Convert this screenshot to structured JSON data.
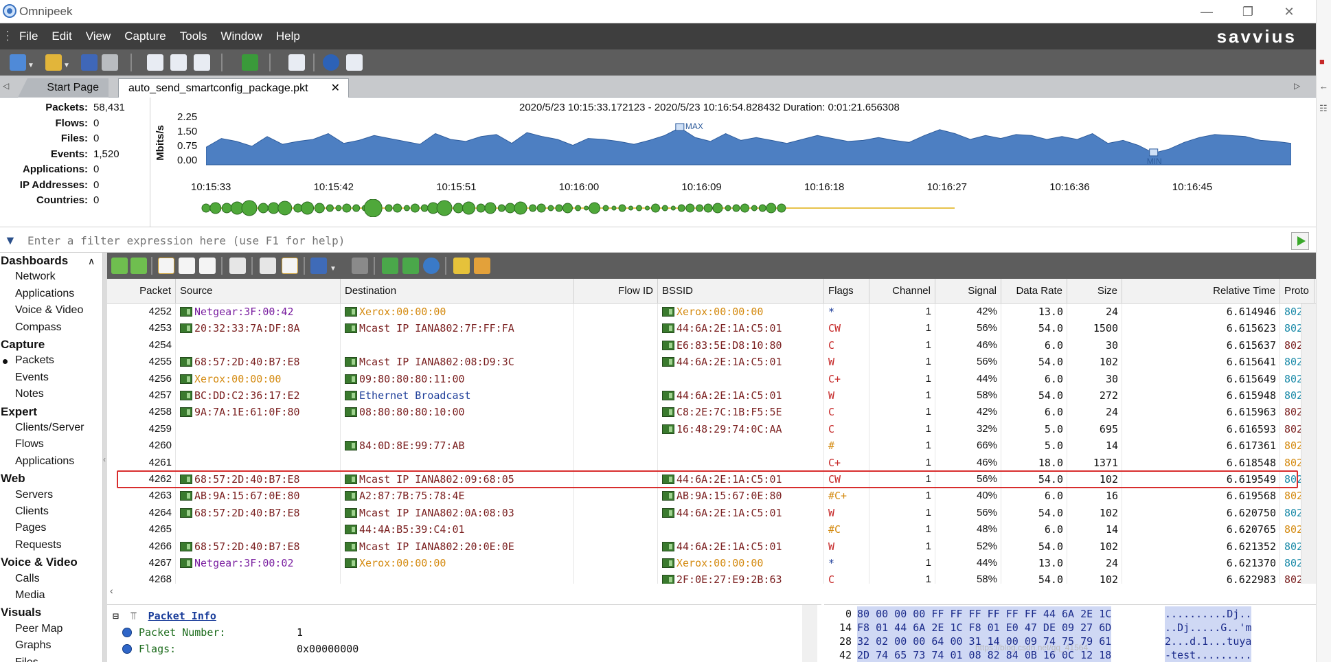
{
  "window": {
    "title": "Omnipeek",
    "minimize": "—",
    "maximize": "❐",
    "close": "✕"
  },
  "menu": [
    "File",
    "Edit",
    "View",
    "Capture",
    "Tools",
    "Window",
    "Help"
  ],
  "brand": "savvius",
  "tabs": {
    "start": "Start Page",
    "file": "auto_send_smartconfig_package.pkt",
    "close": "✕"
  },
  "summary": {
    "stats": [
      {
        "label": "Packets:",
        "value": "58,431"
      },
      {
        "label": "Flows:",
        "value": "0"
      },
      {
        "label": "Files:",
        "value": "0"
      },
      {
        "label": "Events:",
        "value": "1,520"
      },
      {
        "label": "Applications:",
        "value": "0"
      },
      {
        "label": "IP Addresses:",
        "value": "0"
      },
      {
        "label": "Countries:",
        "value": "0"
      }
    ],
    "range": "2020/5/23 10:15:33.172123 - 2020/5/23 10:16:54.828432  Duration: 0:01:21.656308",
    "y_title": "Mbits/s",
    "y_ticks": [
      "2.25",
      "1.50",
      "0.75",
      "0.00"
    ],
    "x_ticks": [
      "10:15:33",
      "10:15:42",
      "10:15:51",
      "10:16:00",
      "10:16:09",
      "10:16:18",
      "10:16:27",
      "10:16:36",
      "10:16:45"
    ],
    "max_label": "MAX",
    "min_label": "MIN"
  },
  "chart_data": {
    "type": "area",
    "title": "",
    "ylabel": "Mbits/s",
    "ylim": [
      0,
      2.25
    ],
    "x": [
      "10:15:33",
      "10:15:42",
      "10:15:51",
      "10:16:00",
      "10:16:09",
      "10:16:18",
      "10:16:27",
      "10:16:36",
      "10:16:45"
    ],
    "values": [
      0.9,
      1.35,
      1.2,
      0.95,
      1.45,
      1.05,
      1.2,
      1.3,
      1.6,
      1.1,
      1.25,
      1.5,
      1.35,
      1.2,
      1.05,
      1.6,
      1.3,
      1.2,
      1.45,
      1.55,
      1.1,
      1.65,
      1.45,
      1.3,
      1.0,
      1.35,
      1.3,
      1.2,
      1.05,
      1.25,
      1.5,
      1.9,
      1.4,
      1.2,
      1.6,
      1.25,
      1.4,
      1.25,
      1.1,
      1.3,
      1.5,
      1.35,
      1.2,
      1.25,
      1.4,
      1.25,
      1.15,
      1.5,
      1.8,
      1.6,
      1.3,
      1.5,
      1.35,
      1.55,
      1.5,
      1.3,
      1.45,
      1.3,
      1.6,
      1.1,
      1.25,
      1.0,
      0.6,
      0.8,
      1.15,
      1.4,
      1.55,
      1.5,
      1.45,
      1.25,
      1.2,
      1.1
    ]
  },
  "filter": {
    "placeholder": "Enter a filter expression here (use F1 for help)"
  },
  "nav": {
    "groups": [
      {
        "head": "Dashboards",
        "items": [
          "Network",
          "Applications",
          "Voice & Video",
          "Compass"
        ]
      },
      {
        "head": "Capture",
        "items": [
          "Packets",
          "Events",
          "Notes"
        ]
      },
      {
        "head": "Expert",
        "items": [
          "Clients/Server",
          "Flows",
          "Applications"
        ]
      },
      {
        "head": "Web",
        "items": [
          "Servers",
          "Clients",
          "Pages",
          "Requests"
        ]
      },
      {
        "head": "Voice & Video",
        "items": [
          "Calls",
          "Media"
        ]
      },
      {
        "head": "Visuals",
        "items": [
          "Peer Map",
          "Graphs",
          "Files"
        ]
      }
    ],
    "active": "Packets"
  },
  "columns": [
    "Packet",
    "Source",
    "Destination",
    "Flow ID",
    "BSSID",
    "Flags",
    "Channel",
    "Signal",
    "Data Rate",
    "Size",
    "Relative Time",
    "Proto"
  ],
  "colors": {
    "purple": "#7a1fa0",
    "orange": "#d48a10",
    "darkred": "#7a1f1f",
    "blue": "#1f3f9a",
    "red": "#c62828",
    "teal": "#1a8aa8"
  },
  "rows": [
    {
      "packet": "4252",
      "src": "Netgear:3F:00:42",
      "srcColor": "purple",
      "dst": "Xerox:00:00:00",
      "dstColor": "orange",
      "bssid": "Xerox:00:00:00",
      "bssidColor": "orange",
      "flags": "*",
      "channel": "1",
      "signal": "42%",
      "rate": "13.0",
      "size": "24",
      "time": "6.614946",
      "proto": "802",
      "protoColor": "teal"
    },
    {
      "packet": "4253",
      "src": "20:32:33:7A:DF:8A",
      "srcColor": "darkred",
      "dst": "Mcast IP IANA802:7F:FF:FA",
      "dstColor": "darkred",
      "bssid": "44:6A:2E:1A:C5:01",
      "bssidColor": "darkred",
      "flags": "CW",
      "channel": "1",
      "signal": "56%",
      "rate": "54.0",
      "size": "1500",
      "time": "6.615623",
      "proto": "802",
      "protoColor": "teal"
    },
    {
      "packet": "4254",
      "src": "",
      "srcColor": "darkred",
      "dst": "",
      "dstColor": "darkred",
      "bssid": "E6:83:5E:D8:10:80",
      "bssidColor": "darkred",
      "flags": "C",
      "channel": "1",
      "signal": "46%",
      "rate": "6.0",
      "size": "30",
      "time": "6.615637",
      "proto": "802",
      "protoColor": "darkred"
    },
    {
      "packet": "4255",
      "src": "68:57:2D:40:B7:E8",
      "srcColor": "darkred",
      "dst": "Mcast IP IANA802:08:D9:3C",
      "dstColor": "darkred",
      "bssid": "44:6A:2E:1A:C5:01",
      "bssidColor": "darkred",
      "flags": "W",
      "channel": "1",
      "signal": "56%",
      "rate": "54.0",
      "size": "102",
      "time": "6.615641",
      "proto": "802",
      "protoColor": "teal"
    },
    {
      "packet": "4256",
      "src": "Xerox:00:00:00",
      "srcColor": "orange",
      "dst": "09:80:80:80:11:00",
      "dstColor": "darkred",
      "bssid": "",
      "bssidColor": "darkred",
      "flags": "C+",
      "channel": "1",
      "signal": "44%",
      "rate": "6.0",
      "size": "30",
      "time": "6.615649",
      "proto": "802",
      "protoColor": "teal"
    },
    {
      "packet": "4257",
      "src": "BC:DD:C2:36:17:E2",
      "srcColor": "darkred",
      "dst": "Ethernet Broadcast",
      "dstColor": "blue",
      "bssid": "44:6A:2E:1A:C5:01",
      "bssidColor": "darkred",
      "flags": "W",
      "channel": "1",
      "signal": "58%",
      "rate": "54.0",
      "size": "272",
      "time": "6.615948",
      "proto": "802",
      "protoColor": "teal"
    },
    {
      "packet": "4258",
      "src": "9A:7A:1E:61:0F:80",
      "srcColor": "darkred",
      "dst": "08:80:80:80:10:00",
      "dstColor": "darkred",
      "bssid": "C8:2E:7C:1B:F5:5E",
      "bssidColor": "darkred",
      "flags": "C",
      "channel": "1",
      "signal": "42%",
      "rate": "6.0",
      "size": "24",
      "time": "6.615963",
      "proto": "802",
      "protoColor": "darkred"
    },
    {
      "packet": "4259",
      "src": "",
      "srcColor": "darkred",
      "dst": "",
      "dstColor": "darkred",
      "bssid": "16:48:29:74:0C:AA",
      "bssidColor": "darkred",
      "flags": "C",
      "channel": "1",
      "signal": "32%",
      "rate": "5.0",
      "size": "695",
      "time": "6.616593",
      "proto": "802",
      "protoColor": "darkred"
    },
    {
      "packet": "4260",
      "src": "",
      "srcColor": "darkred",
      "dst": "84:0D:8E:99:77:AB",
      "dstColor": "darkred",
      "bssid": "",
      "bssidColor": "darkred",
      "flags": "#",
      "channel": "1",
      "signal": "66%",
      "rate": "5.0",
      "size": "14",
      "time": "6.617361",
      "proto": "802",
      "protoColor": "orange"
    },
    {
      "packet": "4261",
      "src": "",
      "srcColor": "darkred",
      "dst": "",
      "dstColor": "darkred",
      "bssid": "",
      "bssidColor": "darkred",
      "flags": "C+",
      "channel": "1",
      "signal": "46%",
      "rate": "18.0",
      "size": "1371",
      "time": "6.618548",
      "proto": "802",
      "protoColor": "orange"
    },
    {
      "packet": "4262",
      "src": "68:57:2D:40:B7:E8",
      "srcColor": "darkred",
      "dst": "Mcast IP IANA802:09:68:05",
      "dstColor": "darkred",
      "bssid": "44:6A:2E:1A:C5:01",
      "bssidColor": "darkred",
      "flags": "CW",
      "channel": "1",
      "signal": "56%",
      "rate": "54.0",
      "size": "102",
      "time": "6.619549",
      "proto": "802",
      "protoColor": "teal"
    },
    {
      "packet": "4263",
      "src": "AB:9A:15:67:0E:80",
      "srcColor": "darkred",
      "dst": "A2:87:7B:75:78:4E",
      "dstColor": "darkred",
      "bssid": "AB:9A:15:67:0E:80",
      "bssidColor": "darkred",
      "flags": "#C+",
      "channel": "1",
      "signal": "40%",
      "rate": "6.0",
      "size": "16",
      "time": "6.619568",
      "proto": "802",
      "protoColor": "orange"
    },
    {
      "packet": "4264",
      "src": "68:57:2D:40:B7:E8",
      "srcColor": "darkred",
      "dst": "Mcast IP IANA802:0A:08:03",
      "dstColor": "darkred",
      "bssid": "44:6A:2E:1A:C5:01",
      "bssidColor": "darkred",
      "flags": "W",
      "channel": "1",
      "signal": "56%",
      "rate": "54.0",
      "size": "102",
      "time": "6.620750",
      "proto": "802",
      "protoColor": "teal"
    },
    {
      "packet": "4265",
      "src": "",
      "srcColor": "darkred",
      "dst": "44:4A:B5:39:C4:01",
      "dstColor": "darkred",
      "bssid": "",
      "bssidColor": "darkred",
      "flags": "#C",
      "channel": "1",
      "signal": "48%",
      "rate": "6.0",
      "size": "14",
      "time": "6.620765",
      "proto": "802",
      "protoColor": "orange"
    },
    {
      "packet": "4266",
      "src": "68:57:2D:40:B7:E8",
      "srcColor": "darkred",
      "dst": "Mcast IP IANA802:20:0E:0E",
      "dstColor": "darkred",
      "bssid": "44:6A:2E:1A:C5:01",
      "bssidColor": "darkred",
      "flags": "W",
      "channel": "1",
      "signal": "52%",
      "rate": "54.0",
      "size": "102",
      "time": "6.621352",
      "proto": "802",
      "protoColor": "teal"
    },
    {
      "packet": "4267",
      "src": "Netgear:3F:00:02",
      "srcColor": "purple",
      "dst": "Xerox:00:00:00",
      "dstColor": "orange",
      "bssid": "Xerox:00:00:00",
      "bssidColor": "orange",
      "flags": "*",
      "channel": "1",
      "signal": "44%",
      "rate": "13.0",
      "size": "24",
      "time": "6.621370",
      "proto": "802",
      "protoColor": "teal"
    },
    {
      "packet": "4268",
      "src": "",
      "srcColor": "darkred",
      "dst": "",
      "dstColor": "darkred",
      "bssid": "2F:0E:27:E9:2B:63",
      "bssidColor": "darkred",
      "flags": "C",
      "channel": "1",
      "signal": "58%",
      "rate": "54.0",
      "size": "102",
      "time": "6.622983",
      "proto": "802.",
      "protoColor": "darkred"
    }
  ],
  "details": {
    "title": "Packet Info",
    "fields": [
      {
        "label": "Packet Number:",
        "value": "1"
      },
      {
        "label": "Flags:",
        "value": "0x00000000"
      }
    ]
  },
  "hex": [
    {
      "off": "0",
      "bytes": "80 00 00 00 FF FF FF FF FF FF 44 6A 2E 1C",
      "ascii": "..........Dj.."
    },
    {
      "off": "14",
      "bytes": "F8 01 44 6A 2E 1C F8 01 E0 47 DE 09 27 6D",
      "ascii": "..Dj.....G..'m"
    },
    {
      "off": "28",
      "bytes": "32 02 00 00 64 00 31 14 00 09 74 75 79 61",
      "ascii": "2...d.1...tuya"
    },
    {
      "off": "42",
      "bytes": "2D 74 65 73 74 01 08 82 84 0B 16 0C 12 18",
      "ascii": "-test........."
    }
  ],
  "watermark": "https://blog.csdn.net/qq_41564"
}
